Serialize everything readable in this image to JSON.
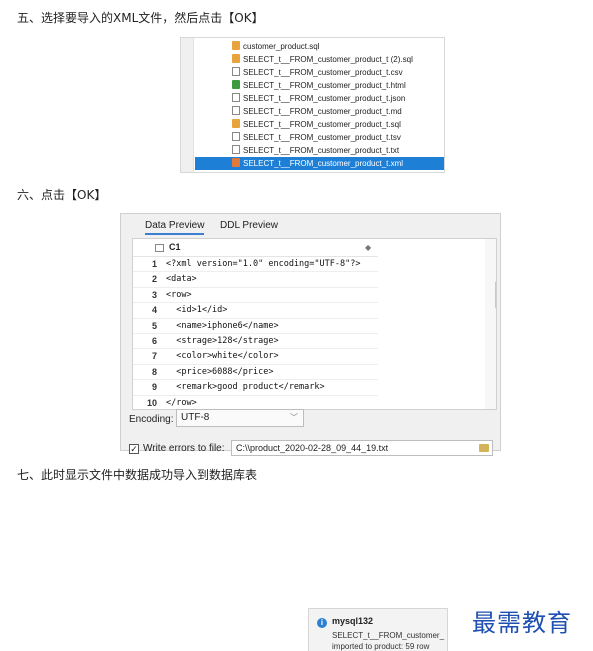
{
  "steps": {
    "step5": "五、选择要导入的XML文件，然后点击【OK】",
    "step6": "六、点击【OK】",
    "step7": "七、此时显示文件中数据成功导入到数据库表"
  },
  "file_list": {
    "files": [
      {
        "name": "customer_product.sql",
        "icon": "sql-file-icon"
      },
      {
        "name": "SELECT_t__FROM_customer_product_t (2).sql",
        "icon": "sql-file-icon"
      },
      {
        "name": "SELECT_t__FROM_customer_product_t.csv",
        "icon": "document-file-icon"
      },
      {
        "name": "SELECT_t__FROM_customer_product_t.html",
        "icon": "html-file-icon"
      },
      {
        "name": "SELECT_t__FROM_customer_product_t.json",
        "icon": "document-file-icon"
      },
      {
        "name": "SELECT_t__FROM_customer_product_t.md",
        "icon": "document-file-icon"
      },
      {
        "name": "SELECT_t__FROM_customer_product_t.sql",
        "icon": "sql-file-icon"
      },
      {
        "name": "SELECT_t__FROM_customer_product_t.tsv",
        "icon": "document-file-icon"
      },
      {
        "name": "SELECT_t__FROM_customer_product_t.txt",
        "icon": "document-file-icon"
      },
      {
        "name": "SELECT_t__FROM_customer_product_t.xml",
        "icon": "xml-file-icon",
        "selected": true
      }
    ]
  },
  "preview": {
    "tabs": [
      "Data Preview",
      "DDL Preview"
    ],
    "active_tab": "Data Preview",
    "column": "C1",
    "rows": [
      {
        "num": "1",
        "text": "<?xml version=\"1.0\" encoding=\"UTF-8\"?>"
      },
      {
        "num": "2",
        "text": "<data>"
      },
      {
        "num": "3",
        "text": "<row>"
      },
      {
        "num": "4",
        "text": "  <id>1</id>"
      },
      {
        "num": "5",
        "text": "  <name>iphone6</name>"
      },
      {
        "num": "6",
        "text": "  <strage>128</strage>"
      },
      {
        "num": "7",
        "text": "  <color>white</color>"
      },
      {
        "num": "8",
        "text": "  <price>6088</price>"
      },
      {
        "num": "9",
        "text": "  <remark>good product</remark>"
      },
      {
        "num": "10",
        "text": "</row>"
      }
    ],
    "encoding_label": "Encoding:",
    "encoding_value": "UTF-8",
    "write_errors_label": "Write errors to file:",
    "write_errors_checked": true,
    "error_file_path": "C:\\\\product_2020-02-28_09_44_19.txt"
  },
  "notification": {
    "title": "mysql132",
    "line1": "SELECT_t__FROM_customer_",
    "line2": "imported to product: 59 row"
  },
  "watermark": "最需教育"
}
